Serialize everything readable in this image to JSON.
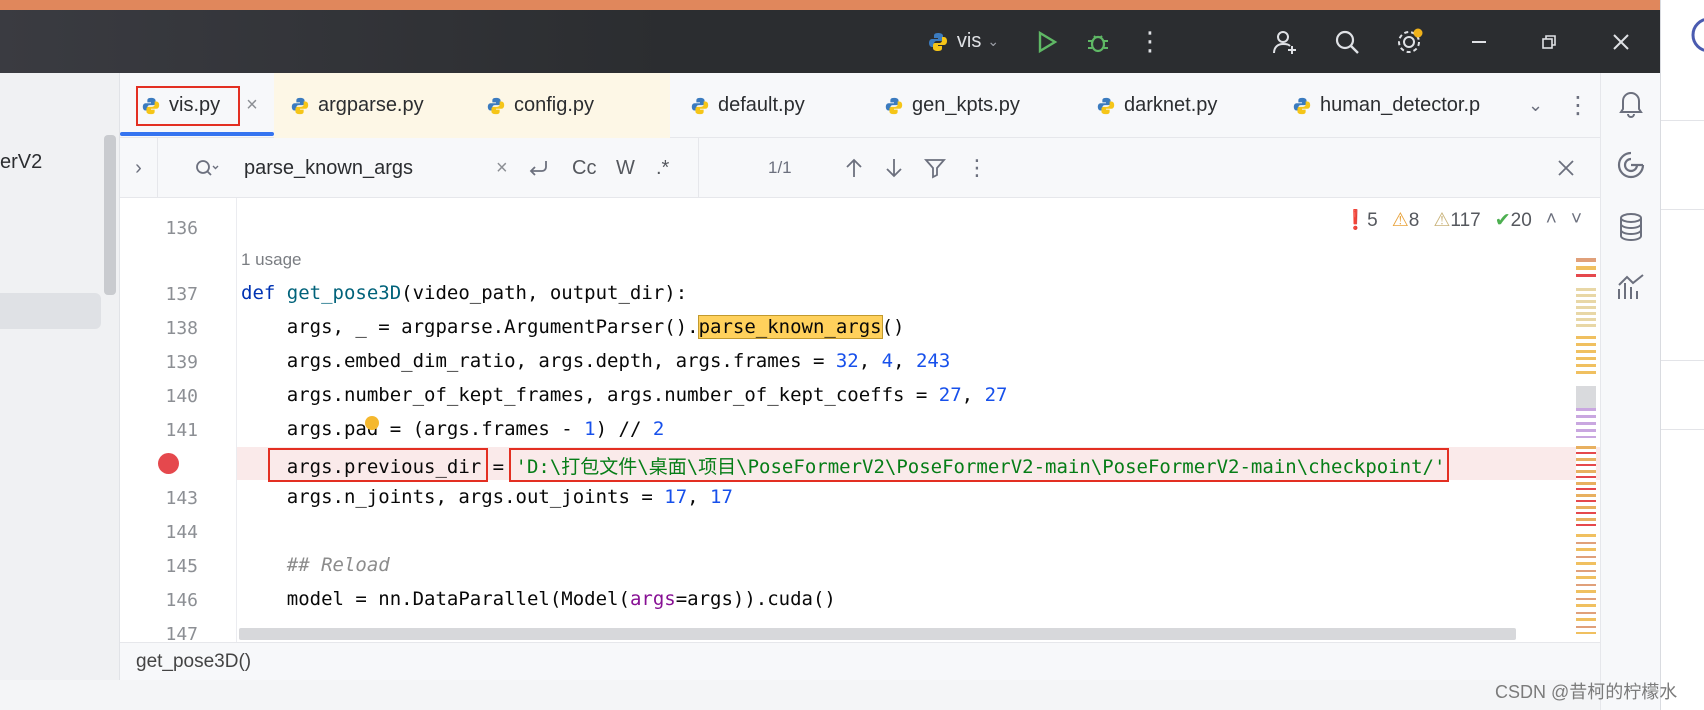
{
  "titlebar": {
    "run_config": "vis",
    "accent_orange": "#e0875c"
  },
  "left_panel": {
    "truncated_project": "erV2"
  },
  "tabs": [
    {
      "label": "vis.py",
      "active": true
    },
    {
      "label": "argparse.py"
    },
    {
      "label": "config.py"
    },
    {
      "label": "default.py"
    },
    {
      "label": "gen_kpts.py"
    },
    {
      "label": "darknet.py"
    },
    {
      "label": "human_detector.p"
    }
  ],
  "find": {
    "query": "parse_known_args",
    "match_case": "Cc",
    "words": "W",
    "regex": ".*",
    "count": "1/1"
  },
  "inspections": {
    "errors": "5",
    "warnings": "8",
    "weak_warnings": "117",
    "ok": "20"
  },
  "editor": {
    "usage_hint": "1 usage",
    "lines": [
      {
        "n": "136"
      },
      {
        "n": "137"
      },
      {
        "n": "138"
      },
      {
        "n": "139"
      },
      {
        "n": "140"
      },
      {
        "n": "141"
      },
      {
        "n": "143"
      },
      {
        "n": "144"
      },
      {
        "n": "145"
      },
      {
        "n": "146"
      },
      {
        "n": "147"
      }
    ],
    "code": {
      "l137_def": "def ",
      "l137_fn": "get_pose3D",
      "l137_rest": "(video_path, output_dir):",
      "l138_a": "    args, _ = argparse.ArgumentParser().",
      "l138_hl": "parse_known_args",
      "l138_b": "()",
      "l139_a": "    args.embed_dim_ratio, args.depth, args.frames = ",
      "l139_n1": "32",
      "l139_c1": ", ",
      "l139_n2": "4",
      "l139_c2": ", ",
      "l139_n3": "243",
      "l140_a": "    args.number_of_kept_frames, args.number_of_kept_coeffs = ",
      "l140_n1": "27",
      "l140_c1": ", ",
      "l140_n2": "27",
      "l141_a": "    args.pad = (args.frames - ",
      "l141_n1": "1",
      "l141_b": ") // ",
      "l141_n2": "2",
      "l142_a": "    args.previous_dir",
      "l142_eq": " = ",
      "l142_str": "'D:\\打包文件\\桌面\\项目\\PoseFormerV2\\PoseFormerV2-main\\PoseFormerV2-main\\checkpoint/'",
      "l143_a": "    args.n_joints, args.out_joints = ",
      "l143_n1": "17",
      "l143_c1": ", ",
      "l143_n2": "17",
      "l145_cmt": "    ## Reload",
      "l146_a": "    model = nn.DataParallel(Model(",
      "l146_p": "args",
      "l146_b": "=args)).cuda()"
    }
  },
  "breadcrumb": "get_pose3D()",
  "watermark": "CSDN @昔柯的柠檬水"
}
